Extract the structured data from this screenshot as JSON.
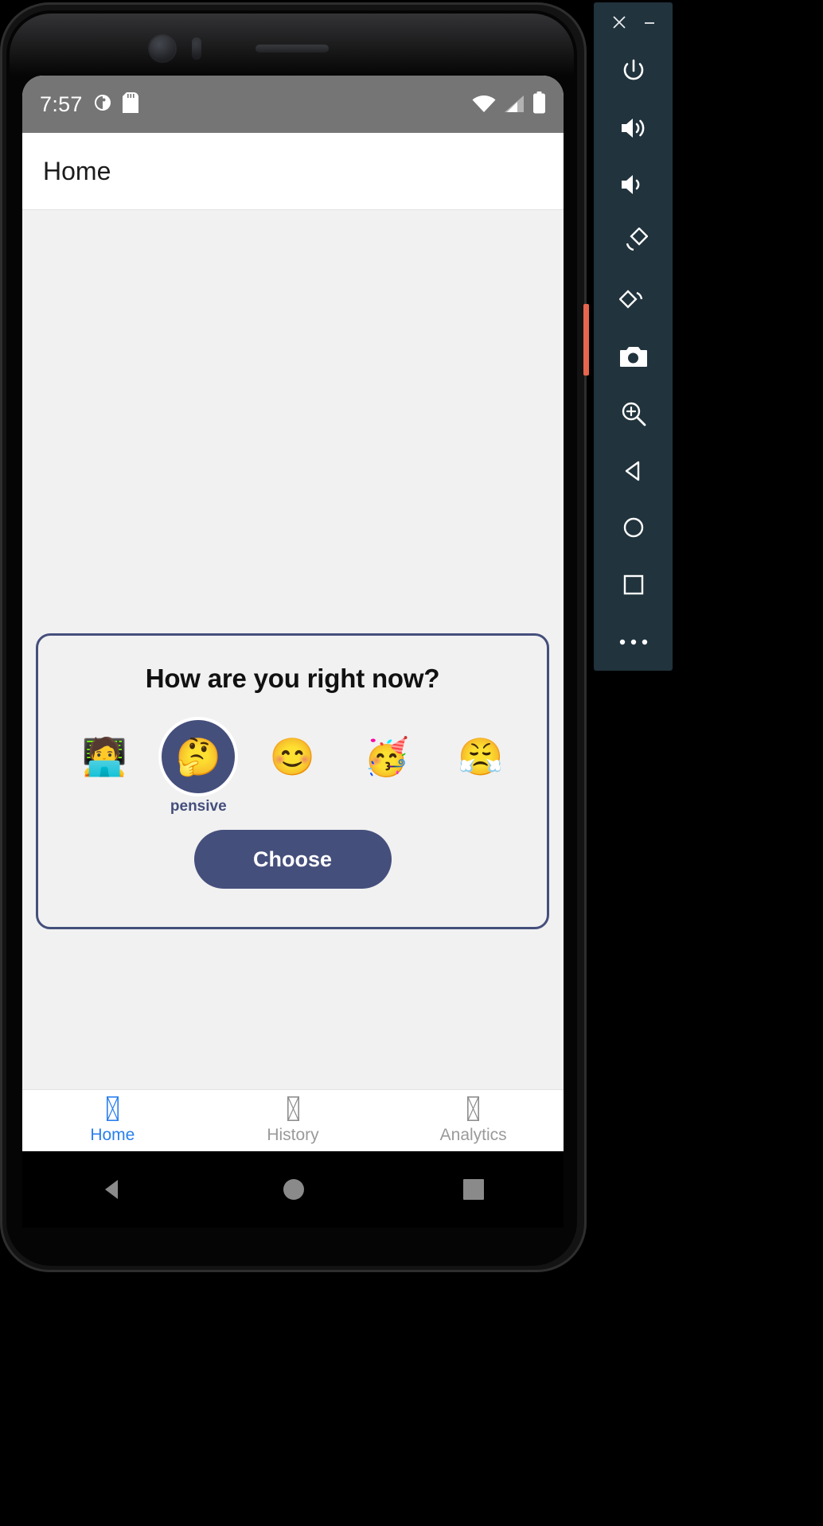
{
  "device": {
    "status_bar": {
      "time": "7:57",
      "left_icons": [
        "alarm-icon",
        "sd-card-icon"
      ],
      "right_icons": [
        "wifi-icon",
        "cellular-signal-icon",
        "battery-icon"
      ]
    },
    "app_bar": {
      "title": "Home"
    },
    "mood_card": {
      "question": "How are you right now?",
      "moods": [
        {
          "emoji": "🧑‍💻",
          "name": "working",
          "label": "",
          "selected": false
        },
        {
          "emoji": "🤔",
          "name": "pensive",
          "label": "pensive",
          "selected": true
        },
        {
          "emoji": "😊",
          "name": "happy",
          "label": "",
          "selected": false
        },
        {
          "emoji": "🥳",
          "name": "partying",
          "label": "",
          "selected": false
        },
        {
          "emoji": "😤",
          "name": "angry",
          "label": "",
          "selected": false
        }
      ],
      "choose_button": "Choose"
    },
    "bottom_nav": [
      {
        "label": "Home",
        "icon": "tofu-box-icon",
        "active": true
      },
      {
        "label": "History",
        "icon": "tofu-box-icon",
        "active": false
      },
      {
        "label": "Analytics",
        "icon": "tofu-box-icon",
        "active": false
      }
    ],
    "system_nav": [
      "back-triangle-icon",
      "home-circle-icon",
      "recents-square-icon"
    ]
  },
  "emulator_toolbar": {
    "window_buttons": [
      {
        "name": "close-window-button",
        "glyph": "×"
      },
      {
        "name": "minimize-window-button",
        "glyph": "–"
      }
    ],
    "controls": [
      {
        "name": "power-button",
        "icon": "power-icon"
      },
      {
        "name": "volume-up-button",
        "icon": "volume-up-icon"
      },
      {
        "name": "volume-down-button",
        "icon": "volume-down-icon"
      },
      {
        "name": "rotate-left-button",
        "icon": "rotate-left-icon"
      },
      {
        "name": "rotate-right-button",
        "icon": "rotate-right-icon"
      },
      {
        "name": "screenshot-button",
        "icon": "camera-icon"
      },
      {
        "name": "zoom-button",
        "icon": "zoom-in-icon"
      },
      {
        "name": "back-button",
        "icon": "back-triangle-icon"
      },
      {
        "name": "home-button",
        "icon": "home-circle-icon"
      },
      {
        "name": "overview-button",
        "icon": "overview-square-icon"
      },
      {
        "name": "more-button",
        "icon": "more-horizontal-icon"
      }
    ]
  },
  "colors": {
    "accent": "#454f7c",
    "nav_active": "#2a7fee",
    "nav_inactive": "#9a9a9a",
    "status_bar": "#757575",
    "app_background": "#f1f1f1",
    "toolbar_background": "#21333d",
    "side_button": "#e8654e"
  }
}
